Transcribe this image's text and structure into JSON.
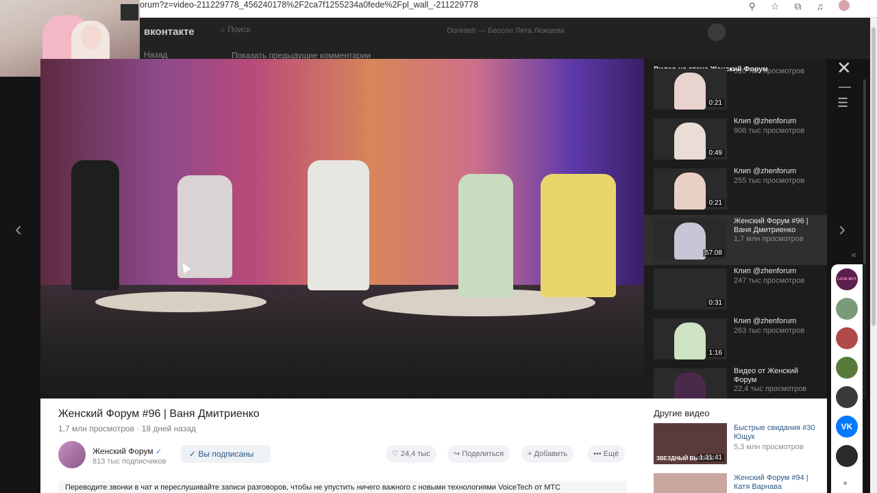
{
  "browser": {
    "url": "orum?z=video-211229778_456240178%2F2ca7f1255234a0fede%2Fpl_wall_-211229778",
    "icons": [
      "location-icon",
      "star-icon",
      "extensions-icon",
      "media-icon",
      "profile-avatar"
    ]
  },
  "vk_header": {
    "logo": "вконтакте",
    "search_placeholder": "Поиск",
    "now_playing": "Ooreaeh — Бессон Лита Лежаева",
    "back_label": "Назад",
    "comments_toggle": "Показать предыдущие комментарии"
  },
  "modal": {
    "controls": [
      "close-icon",
      "minimize-icon",
      "playlist-icon"
    ]
  },
  "playlist": {
    "title": "Видео на стене Женский Форум",
    "items": [
      {
        "title": "",
        "views": "310 тыс просмотров",
        "duration": "0:21",
        "active": false,
        "thumb_color": "#e9d3cf"
      },
      {
        "title": "Клип @zhenforum",
        "views": "908 тыс просмотров",
        "duration": "0:49",
        "active": false,
        "thumb_color": "#e9ddd6"
      },
      {
        "title": "Клип @zhenforum",
        "views": "255 тыс просмотров",
        "duration": "0:21",
        "active": false,
        "thumb_color": "#e9d0c6"
      },
      {
        "title": "Женский Форум #96 | Ваня Дмитриенко",
        "views": "1,7 млн просмотров",
        "duration": "57:08",
        "active": true,
        "thumb_color": "#c6c6d6"
      },
      {
        "title": "Клип @zhenforum",
        "views": "247 тыс просмотров",
        "duration": "0:31",
        "active": false,
        "thumb_color": "#2a2a2a"
      },
      {
        "title": "Клип @zhenforum",
        "views": "263 тыс просмотров",
        "duration": "1:16",
        "active": false,
        "thumb_color": "#cde3c4"
      },
      {
        "title": "Видео от Женский Форум",
        "views": "22,4 тыс просмотров",
        "duration": "",
        "active": false,
        "thumb_color": "#4a2a4a"
      }
    ]
  },
  "video": {
    "title": "Женский Форум #96 | Ваня Дмитриенко",
    "views": "1,7 млн просмотров",
    "age": "18 дней назад",
    "channel": {
      "name": "Женский Форум",
      "verified_mark": "✓",
      "subscribers": "813 тыс подписчиков"
    },
    "subscribed_label": "Вы подписаны",
    "actions": {
      "likes": "24,4 тыс",
      "share": "Поделиться",
      "add": "Добавить",
      "more": "Ещё"
    },
    "promo_text": "Переводите звонки в чат и переслушивайте записи разговоров, чтобы не упустить ничего важного с новыми технологиями VoiceTech от МТС"
  },
  "other_videos": {
    "title": "Другие видео",
    "items": [
      {
        "title": "Быстрые свидания #30 Ющук",
        "views": "5,3 млн просмотров",
        "duration": "1:31:41",
        "thumb_color": "#5a3a3a",
        "thumb_caption": "ЗВЕЗДНЫЙ ВЫПУСК"
      },
      {
        "title": "Женский Форум #94 | Катя Варнава",
        "views": "",
        "duration": "",
        "thumb_color": "#c9a6a0",
        "thumb_caption": ""
      }
    ]
  },
  "rail": {
    "items": [
      {
        "name": "love-bot-chat",
        "label": "LOVE BOT",
        "color": "#5a1f4a"
      },
      {
        "name": "chat-2",
        "label": "",
        "color": "#7a9a7a"
      },
      {
        "name": "chat-3",
        "label": "",
        "color": "#b04a4a"
      },
      {
        "name": "chat-4",
        "label": "",
        "color": "#5a7a3a"
      },
      {
        "name": "chat-5",
        "label": "",
        "color": "#3a3a3a"
      },
      {
        "name": "vk-chat",
        "label": "VK",
        "color": "#0077ff"
      },
      {
        "name": "chat-7",
        "label": "",
        "color": "#2a2a2a"
      }
    ]
  },
  "colors": {
    "accent_link": "#2a5885",
    "verified": "#3f8ae0",
    "panel_bg": "#1c1c1c",
    "vk_blue": "#0077ff"
  }
}
